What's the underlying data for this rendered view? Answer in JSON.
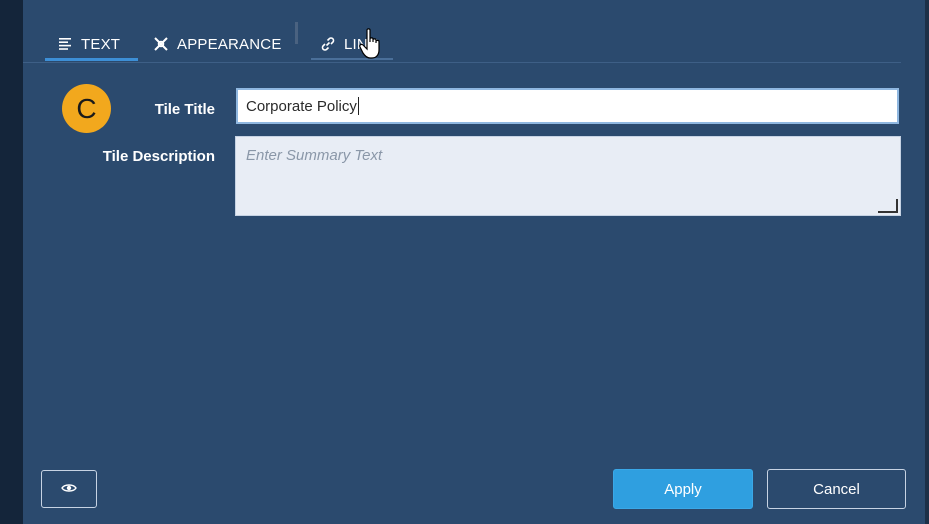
{
  "tabs": {
    "text_label": "TEXT",
    "appearance_label": "APPEARANCE",
    "link_label": "LINK",
    "active": "TEXT"
  },
  "form": {
    "badge_letter": "C",
    "title_label": "Tile Title",
    "title_value": "Corporate Policy",
    "description_label": "Tile Description",
    "description_placeholder": "Enter Summary Text"
  },
  "footer": {
    "apply_label": "Apply",
    "cancel_label": "Cancel"
  },
  "colors": {
    "dialog_bg": "#2b4a6e",
    "accent": "#2f9fe0",
    "badge": "#f2a81d"
  },
  "icons": {
    "text_tab": "text-lines-icon",
    "appearance_tab": "palette-icon",
    "link_tab": "link-icon",
    "preview": "eye-icon"
  }
}
